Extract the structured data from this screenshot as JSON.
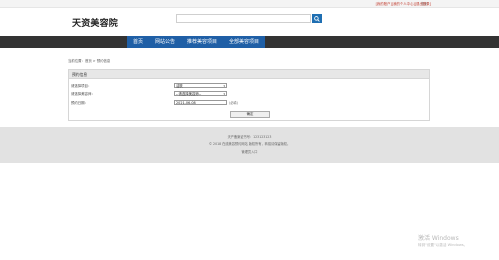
{
  "topbar": {
    "welcome": "您好 ",
    "links": "[我的账户][我的个人中心][退出登录]"
  },
  "header": {
    "logo": "天资美容院",
    "search_placeholder": ""
  },
  "nav": {
    "items": [
      "首页",
      "网站公告",
      "推荐美容项目",
      "全部美容项目"
    ]
  },
  "breadcrumb": "当前位置：首页 > 预约信息",
  "panel": {
    "title": "预约信息",
    "rows": [
      {
        "label": "请选择项目：",
        "value": "洁肤",
        "type": "select"
      },
      {
        "label": "请选择美容师：",
        "value": "--请选择美容师--",
        "type": "select"
      },
      {
        "label": "预约日期：",
        "value": "2021-06-08",
        "type": "input",
        "hint": "(必填)"
      }
    ],
    "submit_label": "确定"
  },
  "footer": {
    "lines": [
      "天产备案证书号：123123123",
      "© 2018 在线美容预约网站 版权所有，转载请保留版权。",
      "管理员入口"
    ]
  },
  "watermark": {
    "title": "激活 Windows",
    "subtitle": "转到\"设置\"以激活 Windows。"
  }
}
